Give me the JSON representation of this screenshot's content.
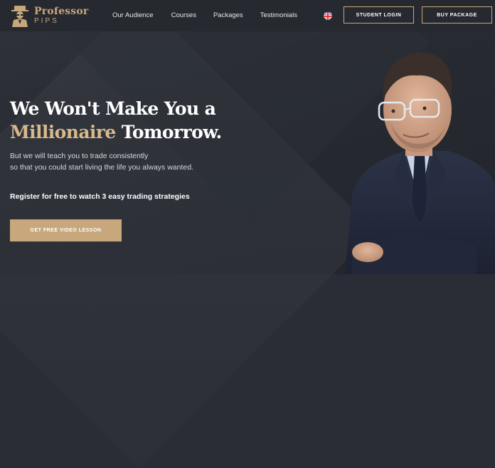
{
  "brand": {
    "name": "Professor",
    "sub": "PIPS"
  },
  "nav": [
    "Our Audience",
    "Courses",
    "Packages",
    "Testimonials"
  ],
  "header": {
    "student_login": "STUDENT LOGIN",
    "buy_package": "BUY PACKAGE",
    "language_flag": "uk-flag-icon"
  },
  "hero": {
    "headline_line1": "We Won't Make You a",
    "headline_highlight": "Millionaire",
    "headline_line2_rest": " Tomorrow.",
    "sub_line1": "But we will teach you to trade consistently",
    "sub_line2": "so that you could start living the life you always wanted.",
    "register": "Register for free to watch 3 easy trading strategies",
    "cta": "GET FREE VIDEO LESSON"
  },
  "colors": {
    "accent": "#c8a77c",
    "background": "#2a2d35"
  }
}
